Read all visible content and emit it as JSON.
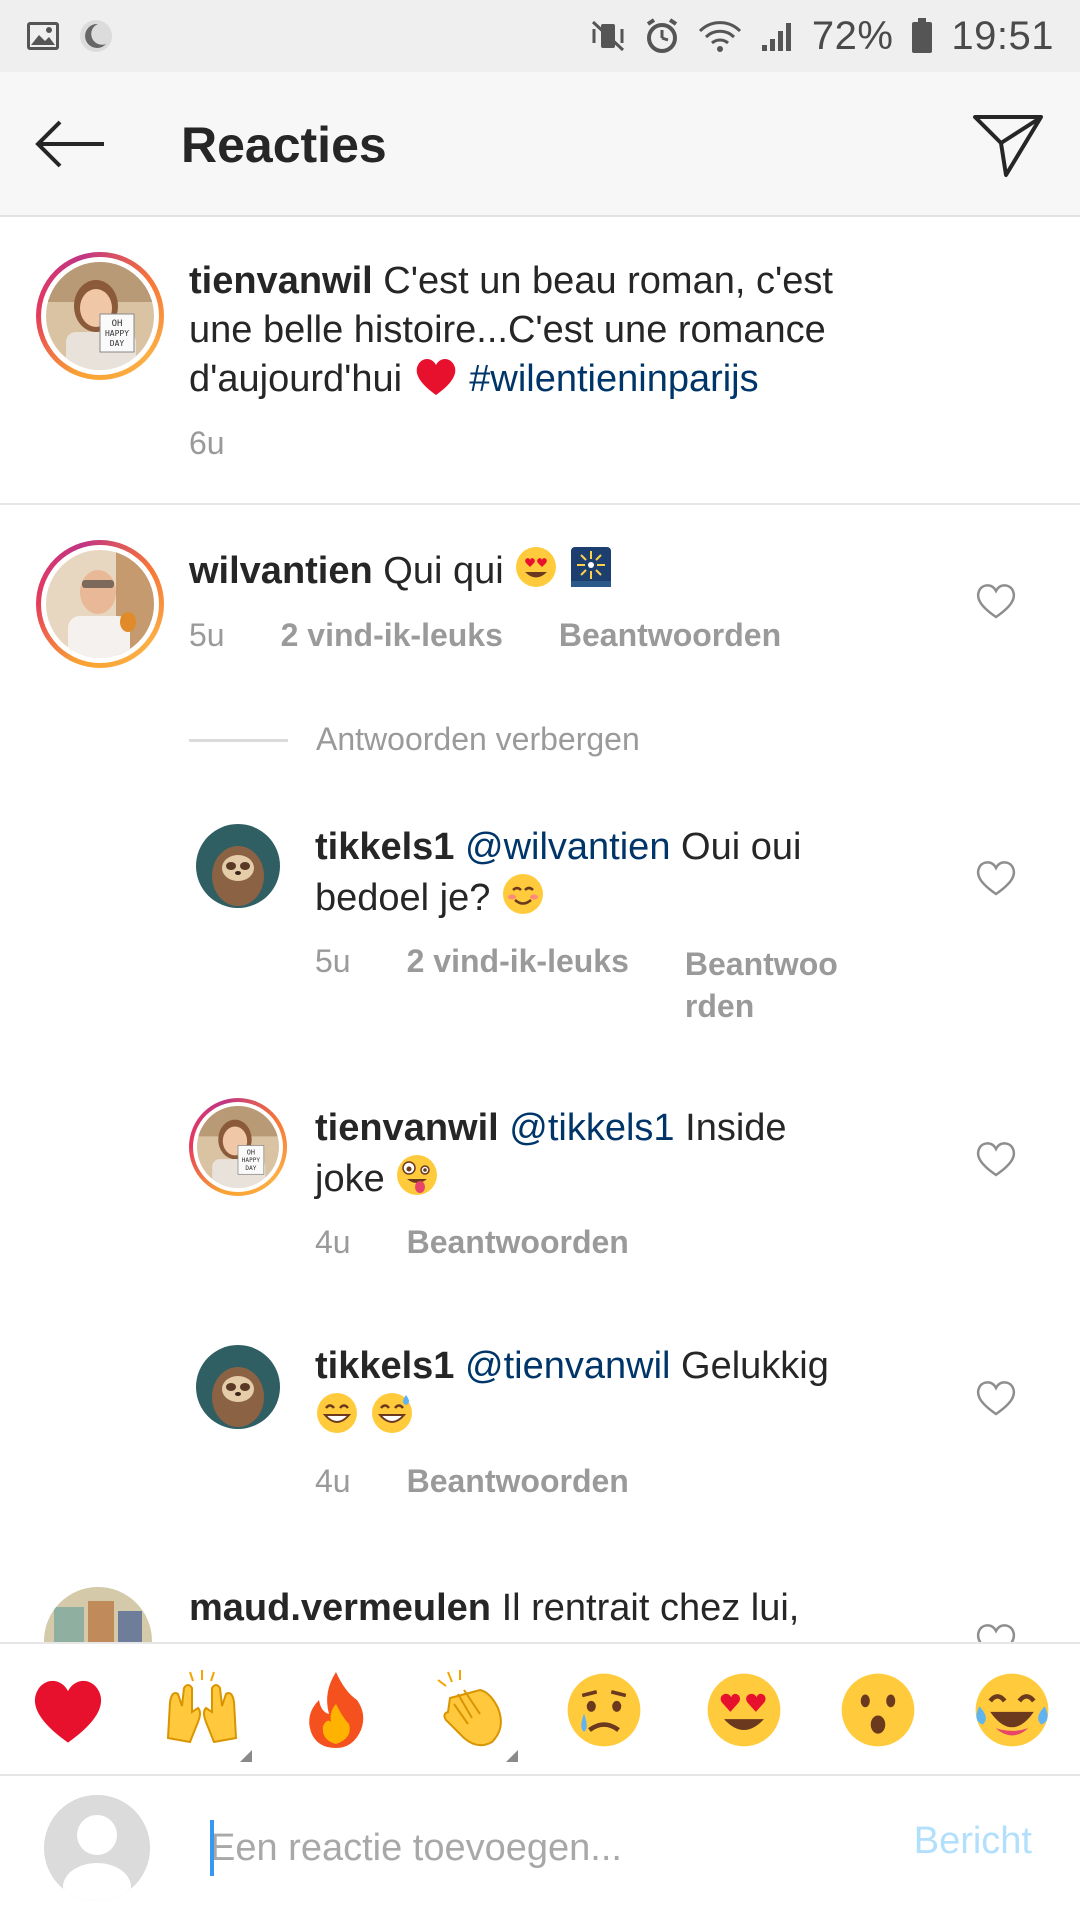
{
  "status_bar": {
    "battery_percent": "72%",
    "time": "19:51",
    "left_icons": [
      "image-icon",
      "moon-icon"
    ],
    "right_icons": [
      "mute-vibrate-icon",
      "alarm-icon",
      "wifi-icon",
      "signal-icon",
      "battery-icon"
    ]
  },
  "header": {
    "title": "Reacties",
    "back_icon": "arrow-left-icon",
    "send_icon": "paper-plane-icon"
  },
  "caption": {
    "username": "tienvanwil",
    "text_line1": "C'est un beau roman, c'est",
    "text_line2": "une belle histoire...C'est une romance",
    "text_line3": "d'aujourd'hui",
    "hashtag": "#wilentieninparijs",
    "time": "6u"
  },
  "comments": [
    {
      "username": "wilvantien",
      "text": "Qui qui",
      "time": "5u",
      "likes": "2 vind-ik-leuks",
      "reply": "Beantwoorden"
    }
  ],
  "replies_toggle": "Antwoorden verbergen",
  "replies": [
    {
      "username": "tikkels1",
      "mention": "@wilvantien",
      "text_a": "Oui oui",
      "text_b": "bedoel je?",
      "time": "5u",
      "likes": "2 vind-ik-leuks",
      "reply_line1": "Beantwoo",
      "reply_line2": "rden"
    },
    {
      "username": "tienvanwil",
      "mention": "@tikkels1",
      "text_a": "Inside",
      "text_b": "joke",
      "time": "4u",
      "reply": "Beantwoorden"
    },
    {
      "username": "tikkels1",
      "mention": "@tienvanwil",
      "text_a": "Gelukkig",
      "time": "4u",
      "reply": "Beantwoorden"
    }
  ],
  "partial_comment": {
    "username": "maud.vermeulen",
    "text": "Il rentrait chez lui,"
  },
  "quick_emojis": [
    "heart",
    "raised-hands",
    "fire",
    "clapping-hands",
    "crying-face",
    "heart-eyes-face",
    "surprised-face",
    "tears-of-joy-face"
  ],
  "input": {
    "placeholder": "Een reactie toevoegen...",
    "post_label": "Bericht"
  },
  "colors": {
    "mention": "#003569",
    "meta_grey": "#9a9a9a",
    "post_disabled": "#b2dffc",
    "heart_red": "#e8112d"
  }
}
